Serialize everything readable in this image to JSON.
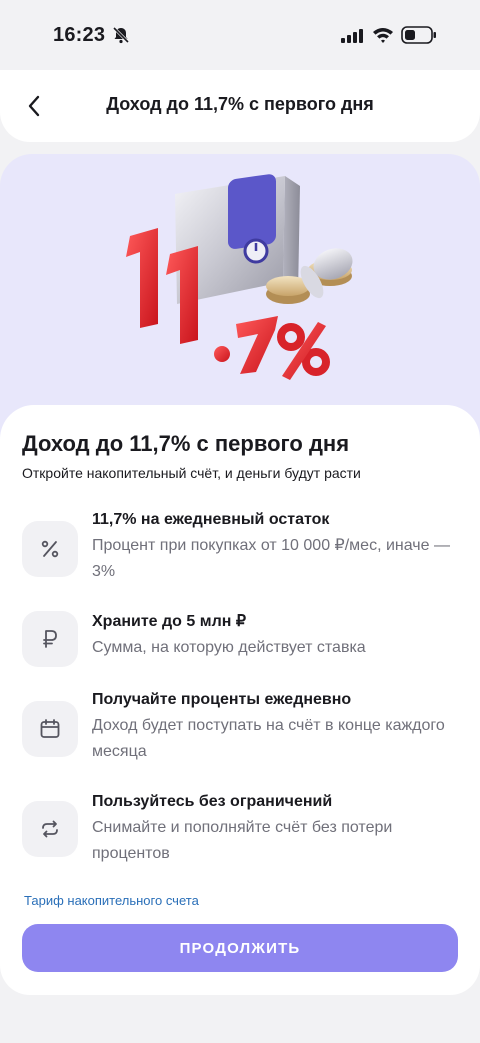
{
  "status_bar": {
    "time": "16:23"
  },
  "nav": {
    "title": "Доход до 11,7% с первого дня"
  },
  "hero": {
    "rate_text": "11,7%"
  },
  "card": {
    "title": "Доход до 11,7% с первого дня",
    "subtitle": "Откройте накопительный счёт, и деньги будут расти",
    "features": [
      {
        "icon": "percent-icon",
        "title": "11,7% на ежедневный остаток",
        "description": "Процент при покупках от 10 000 ₽/мес, иначе — 3%"
      },
      {
        "icon": "ruble-icon",
        "title": "Храните до 5 млн ₽",
        "description": "Сумма, на которую действует ставка"
      },
      {
        "icon": "calendar-icon",
        "title": "Получайте проценты ежедневно",
        "description": "Доход будет поступать на счёт в конце каждого месяца"
      },
      {
        "icon": "refresh-icon",
        "title": "Пользуйтесь без ограничений",
        "description": "Снимайте и пополняйте счёт без потери процентов"
      }
    ],
    "tariff_link": "Тариф накопительного счета",
    "continue_label": "ПРОДОЛЖИТЬ"
  },
  "colors": {
    "accent_button": "#8e86f0",
    "hero_background": "#e8e7fb",
    "link": "#2a6fb8",
    "rate_red": "#e4282d"
  }
}
